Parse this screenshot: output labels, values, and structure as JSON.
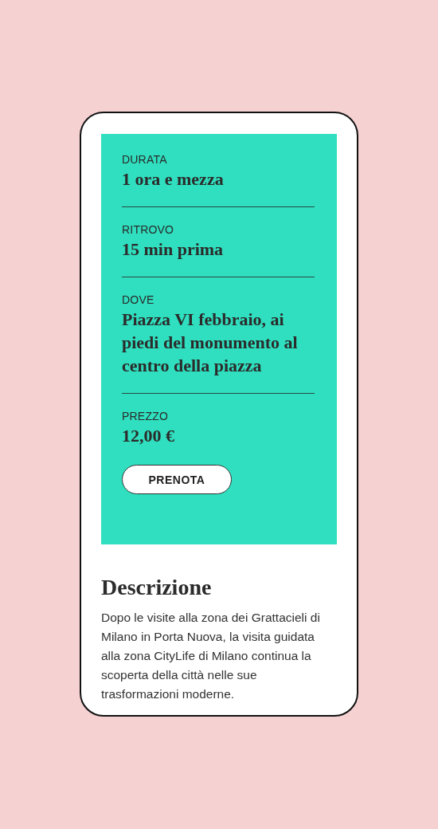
{
  "details": [
    {
      "label": "DURATA",
      "value": "1 ora e mezza"
    },
    {
      "label": "RITROVO",
      "value": "15 min prima"
    },
    {
      "label": "DOVE",
      "value": "Piazza VI febbraio, ai piedi del monumento al centro della piazza"
    },
    {
      "label": "PREZZO",
      "value": "12,00 €"
    }
  ],
  "button": "PRENOTA",
  "description": {
    "title": "Descrizione",
    "text": "Dopo le visite alla zona dei Grattacieli di Milano in Porta Nuova, la visita guidata alla zona CityLife di Milano continua la scoperta della città nelle sue trasformazioni moderne."
  }
}
